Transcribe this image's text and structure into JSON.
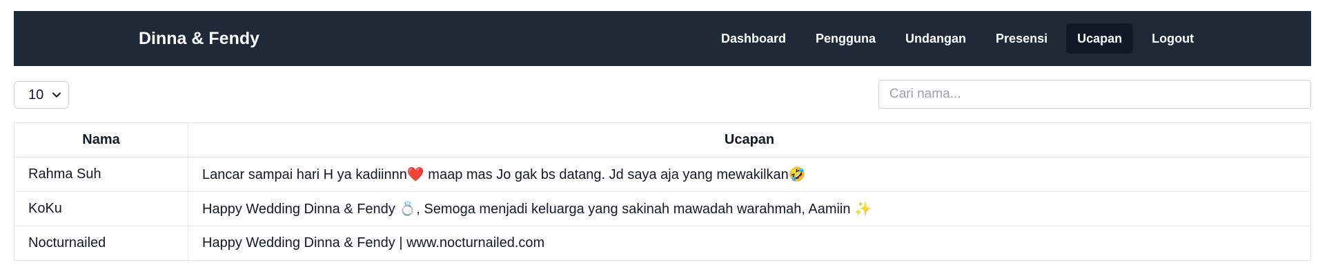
{
  "navbar": {
    "brand": "Dinna & Fendy",
    "items": [
      {
        "label": "Dashboard",
        "active": false
      },
      {
        "label": "Pengguna",
        "active": false
      },
      {
        "label": "Undangan",
        "active": false
      },
      {
        "label": "Presensi",
        "active": false
      },
      {
        "label": "Ucapan",
        "active": true
      },
      {
        "label": "Logout",
        "active": false
      }
    ]
  },
  "controls": {
    "page_size": "10",
    "search_placeholder": "Cari nama...",
    "search_value": ""
  },
  "table": {
    "headers": [
      "Nama",
      "Ucapan"
    ],
    "rows": [
      {
        "nama": "Rahma Suh",
        "ucapan": "Lancar sampai hari H ya kadiinnn❤️ maap mas Jo gak bs datang. Jd saya aja yang mewakilkan🤣"
      },
      {
        "nama": "KoKu",
        "ucapan": "Happy Wedding Dinna & Fendy 💍, Semoga menjadi keluarga yang sakinah mawadah warahmah, Aamiin ✨"
      },
      {
        "nama": "Nocturnailed",
        "ucapan": "Happy Wedding Dinna & Fendy | www.nocturnailed.com"
      }
    ]
  },
  "colors": {
    "navbar_bg": "#1f2937",
    "nav_active_bg": "#111827"
  }
}
